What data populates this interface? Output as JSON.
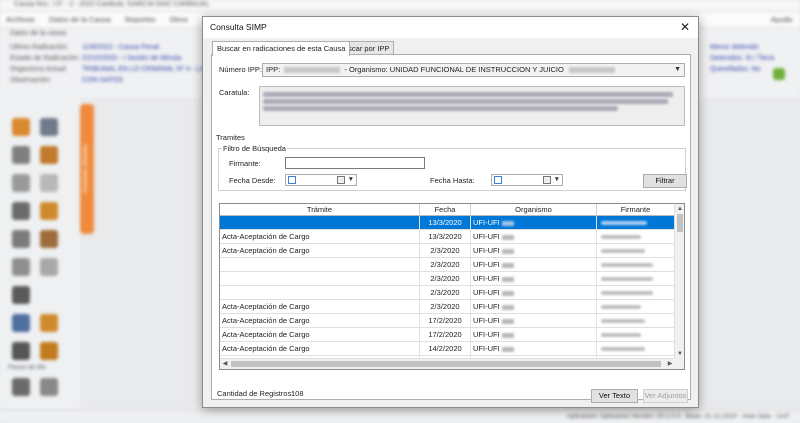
{
  "background": {
    "window_title": "Causa Nro.: I.P. - 2 - 2022 Carátula: GARCIA DIAZ CARBAJAL",
    "menu": [
      "Archivos",
      "Datos de la Causa",
      "Reportes",
      "Otros"
    ],
    "menu_right": "Ayuda",
    "info_rows": [
      {
        "label": "Datos de la causa",
        "value": ""
      },
      {
        "label": "Ultimo Radicación:",
        "value": "11/8/2022 - Causa Penal"
      },
      {
        "label": "Estado de Radicación:",
        "value": "22/10/2020 - I Sesión de Minuta"
      },
      {
        "label": "Organismo Actual:",
        "value": "TRIBUNAL EN LO CRIMINAL Nº 4 - LA PLATA"
      },
      {
        "label": "Observación:",
        "value": "CON DATOS"
      }
    ],
    "right_info": [
      "Menor detenido",
      "Detenidos: Si / Tiene",
      "Querellados: No"
    ],
    "side_tab": "Accesos directos",
    "side_caption": "Pasos de Mo",
    "status": "Aplicación: Aplicación Versión: 20.1.0.3 · Base: 31.12.2020 · Ante Sala · UniT"
  },
  "dialog": {
    "title": "Consulta SIMP",
    "close_label": "✕",
    "tabs": [
      {
        "label": "Buscar en radicaciones de esta Causa"
      },
      {
        "label": "Buscar por IPP"
      }
    ],
    "ipp_label": "Número IPP:",
    "ipp_prefix": "IPP:",
    "ipp_organismo": "- Organismo: UNIDAD FUNCIONAL DE INSTRUCCION Y JUICIO",
    "caratula_label": "Caratula:",
    "tramites_label": "Tramites",
    "filtro_label": "Filtro de Búsqueda",
    "firmante_label": "Firmante:",
    "firmante_value": "",
    "fecha_desde_label": "Fecha Desde:",
    "fecha_hasta_label": "Fecha Hasta:",
    "filtrar_label": "Filtrar",
    "columns": [
      "Trámite",
      "Fecha",
      "Organismo",
      "Firmante"
    ],
    "rows": [
      {
        "tramite": "",
        "fecha": "13/3/2020",
        "organismo": "UFI-UFI",
        "selected": true
      },
      {
        "tramite": "Acta-Aceptación de Cargo",
        "fecha": "13/3/2020",
        "organismo": "UFI-UFI",
        "selected": false
      },
      {
        "tramite": "Acta-Aceptación de Cargo",
        "fecha": "2/3/2020",
        "organismo": "UFI-UFI",
        "selected": false
      },
      {
        "tramite": "",
        "fecha": "2/3/2020",
        "organismo": "UFI-UFI",
        "selected": false
      },
      {
        "tramite": "",
        "fecha": "2/3/2020",
        "organismo": "UFI-UFI",
        "selected": false
      },
      {
        "tramite": "",
        "fecha": "2/3/2020",
        "organismo": "UFI-UFI",
        "selected": false
      },
      {
        "tramite": "Acta-Aceptación de Cargo",
        "fecha": "2/3/2020",
        "organismo": "UFI-UFI",
        "selected": false
      },
      {
        "tramite": "Acta-Aceptación de Cargo",
        "fecha": "17/2/2020",
        "organismo": "UFI-UFI",
        "selected": false
      },
      {
        "tramite": "Acta-Aceptación de Cargo",
        "fecha": "17/2/2020",
        "organismo": "UFI-UFI",
        "selected": false
      },
      {
        "tramite": "Acta-Aceptación de Cargo",
        "fecha": "14/2/2020",
        "organismo": "UFI-UFI",
        "selected": false
      },
      {
        "tramite": "",
        "fecha": "",
        "organismo": "",
        "selected": false
      }
    ],
    "count_label": "Cantidad de Registros:",
    "count_value": "108",
    "ver_texto_label": "Ver Texto",
    "ver_adjuntos_label": "Ver Adjuntos",
    "accent_color": "#0078d7"
  }
}
